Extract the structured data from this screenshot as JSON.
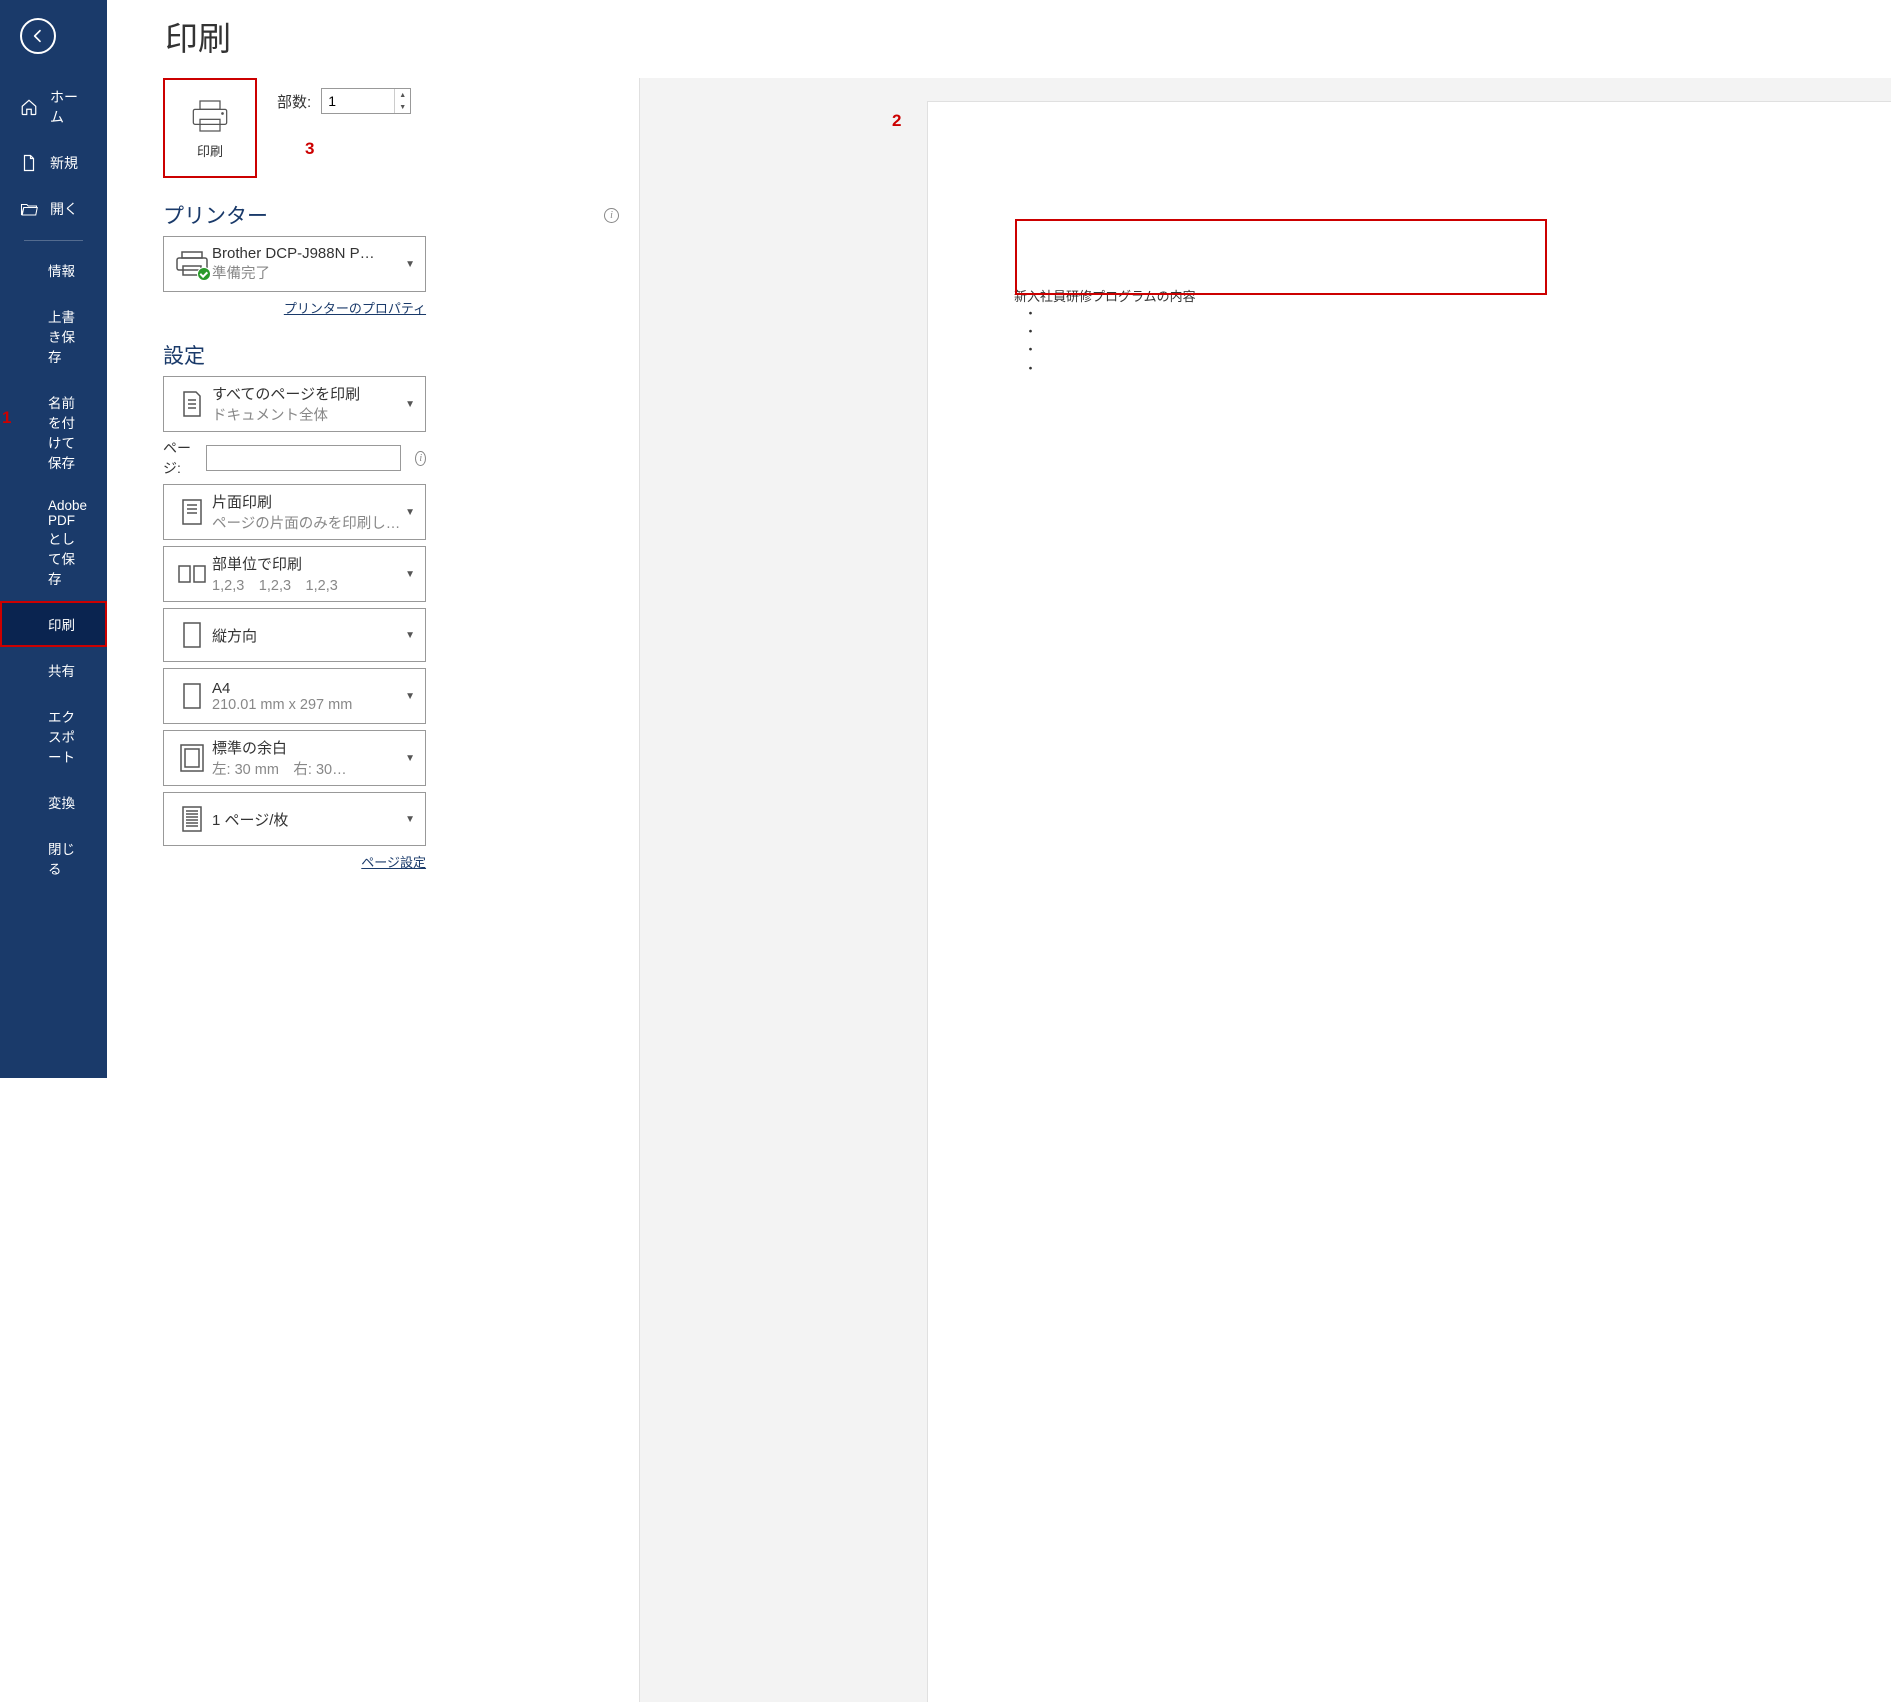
{
  "colors": {
    "sidebar_bg": "#1a3a6a",
    "accent_red": "#c00000",
    "link": "#1a3a6a"
  },
  "annotations": {
    "n1": "1",
    "n2": "2",
    "n3": "3"
  },
  "sidebar": {
    "items": [
      {
        "label": "ホーム",
        "icon": "home-icon"
      },
      {
        "label": "新規",
        "icon": "file-icon"
      },
      {
        "label": "開く",
        "icon": "folder-open-icon"
      }
    ],
    "sub_items": [
      {
        "label": "情報"
      },
      {
        "label": "上書き保存"
      },
      {
        "label": "名前を付けて保存"
      },
      {
        "label": "Adobe PDF として保存"
      },
      {
        "label": "印刷",
        "active": true
      },
      {
        "label": "共有"
      },
      {
        "label": "エクスポート"
      },
      {
        "label": "変換"
      },
      {
        "label": "閉じる"
      }
    ]
  },
  "page": {
    "title": "印刷",
    "print_button_label": "印刷",
    "copies_label": "部数:",
    "copies_value": "1",
    "printer_heading": "プリンター",
    "printer": {
      "name": "Brother DCP-J988N P…",
      "status": "準備完了"
    },
    "printer_properties_link": "プリンターのプロパティ",
    "settings_heading": "設定",
    "pages_label": "ページ:",
    "pages_value": "",
    "options": {
      "range": {
        "title": "すべてのページを印刷",
        "sub": "ドキュメント全体"
      },
      "sides": {
        "title": "片面印刷",
        "sub": "ページの片面のみを印刷し…"
      },
      "collate": {
        "title": "部単位で印刷",
        "sub": "1,2,3　1,2,3　1,2,3"
      },
      "orient": {
        "title": "縦方向",
        "sub": ""
      },
      "paper": {
        "title": "A4",
        "sub": "210.01 mm x 297 mm"
      },
      "margins": {
        "title": "標準の余白",
        "sub": "左:  30 mm　右:  30…"
      },
      "per_sheet": {
        "title": "1 ページ/枚",
        "sub": ""
      }
    },
    "page_setup_link": "ページ設定"
  },
  "preview": {
    "heading": "新入社員研修プログラムの内容",
    "bullets": [
      "・",
      "・",
      "・",
      "・"
    ]
  }
}
